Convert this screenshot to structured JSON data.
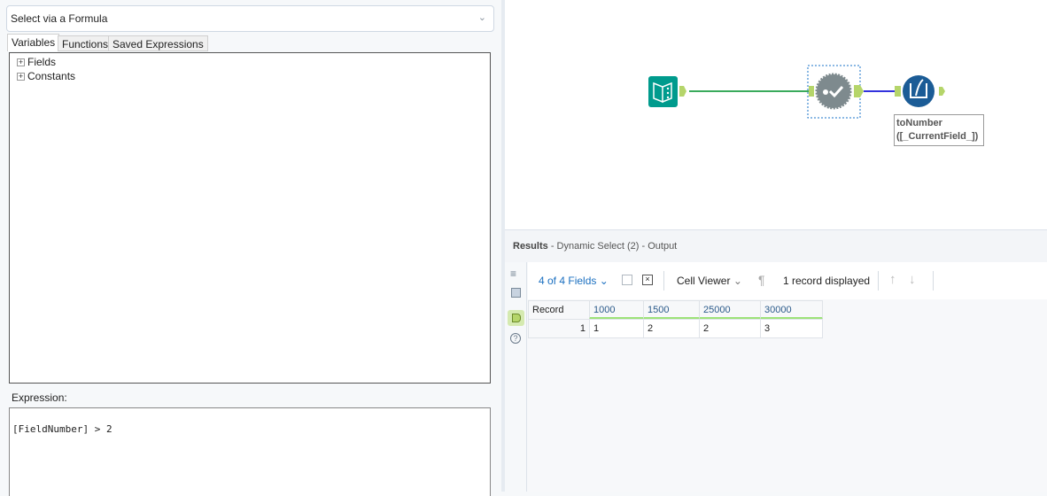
{
  "config": {
    "mode_select": "Select via a Formula",
    "tabs": [
      "Variables",
      "Functions",
      "Saved Expressions"
    ],
    "tree": [
      "Fields",
      "Constants"
    ],
    "expression_label": "Expression:",
    "expression": "[FieldNumber] > 2"
  },
  "canvas": {
    "annotation_line1": "toNumber",
    "annotation_line2": "([_CurrentField_])",
    "colors": {
      "input": "#009b8d",
      "dynamic_select": "#7e8a8e",
      "formula": "#1b5c96",
      "connection_green": "#3aaa5c",
      "connection_blue": "#3333dd",
      "anchor": "#b5d56a"
    }
  },
  "results": {
    "title": "Results",
    "subtitle": "- Dynamic Select (2) - Output",
    "fields": "4 of 4 Fields",
    "cell_viewer": "Cell Viewer",
    "record_count": "1 record displayed",
    "columns": [
      "Record",
      "1000",
      "1500",
      "25000",
      "30000"
    ],
    "rows": [
      [
        "1",
        "1",
        "2",
        "2",
        "3"
      ]
    ]
  }
}
